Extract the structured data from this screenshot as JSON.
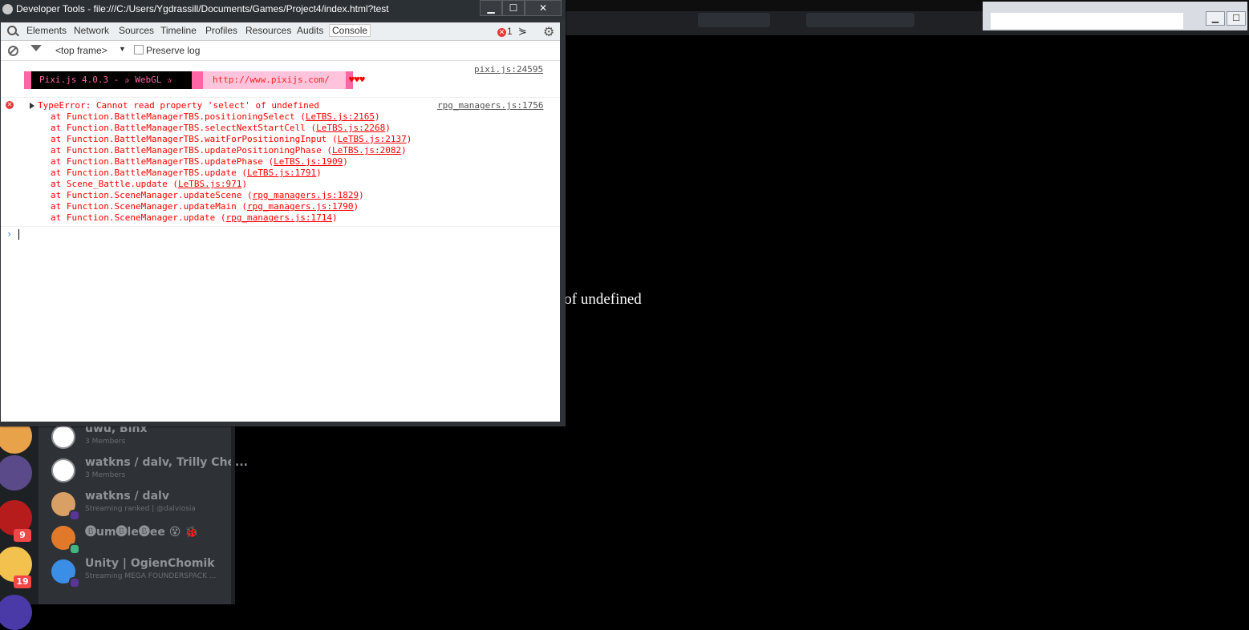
{
  "devtools": {
    "window_title": "Developer Tools - file:///C:/Users/Ygdrassill/Documents/Games/Project4/index.html?test",
    "window_buttons": {
      "minimize": "▁",
      "maximize": "☐",
      "close": "✕"
    },
    "tabs": [
      "Elements",
      "Network",
      "Sources",
      "Timeline",
      "Profiles",
      "Resources",
      "Audits",
      "Console"
    ],
    "active_tab": "Console",
    "error_count": "1",
    "toolbar": {
      "frame_select": "<top frame>",
      "preserve_log_label": "Preserve log",
      "preserve_log_checked": false
    },
    "pixi_banner": {
      "label": "Pixi.js 4.0.3 - ✰ WebGL ✰",
      "url": "http://www.pixijs.com/",
      "hearts": "♥♥♥",
      "source": "pixi.js:24595"
    },
    "error": {
      "message": "TypeError: Cannot read property 'select' of undefined",
      "source": "rpg_managers.js:1756",
      "stack": [
        {
          "text": "at Function.BattleManagerTBS.positioningSelect (",
          "link": "LeTBS.js:2165",
          "end": ")"
        },
        {
          "text": "at Function.BattleManagerTBS.selectNextStartCell (",
          "link": "LeTBS.js:2268",
          "end": ")"
        },
        {
          "text": "at Function.BattleManagerTBS.waitForPositioningInput (",
          "link": "LeTBS.js:2137",
          "end": ")"
        },
        {
          "text": "at Function.BattleManagerTBS.updatePositioningPhase (",
          "link": "LeTBS.js:2082",
          "end": ")"
        },
        {
          "text": "at Function.BattleManagerTBS.updatePhase (",
          "link": "LeTBS.js:1909",
          "end": ")"
        },
        {
          "text": "at Function.BattleManagerTBS.update (",
          "link": "LeTBS.js:1791",
          "end": ")"
        },
        {
          "text": "at Scene_Battle.update (",
          "link": "LeTBS.js:971",
          "end": ")"
        },
        {
          "text": "at Function.SceneManager.updateScene (",
          "link": "rpg_managers.js:1829",
          "end": ")"
        },
        {
          "text": "at Function.SceneManager.updateMain (",
          "link": "rpg_managers.js:1790",
          "end": ")"
        },
        {
          "text": "at Function.SceneManager.update (",
          "link": "rpg_managers.js:1714",
          "end": ")"
        }
      ]
    },
    "prompt": "›"
  },
  "game": {
    "error_title": "TypeError",
    "error_message": "Cannot read property 'select' of undefined"
  },
  "discord": {
    "guild_badges": [
      "9",
      "19"
    ],
    "dms": [
      {
        "name": "uwu, Binx",
        "sub": "3 Members",
        "type": "group"
      },
      {
        "name": "watkns / dalv, Trilly Che...",
        "sub": "3 Members",
        "type": "group"
      },
      {
        "name": "watkns / dalv",
        "sub": "Streaming ranked | @dalviosia",
        "type": "user",
        "status_color": "#593695"
      },
      {
        "name": "🅑um🅑le🅑ee 😵 🐞",
        "sub": "",
        "type": "user",
        "status_color": "#43b581"
      },
      {
        "name": "Unity | OgienChomik",
        "sub": "Streaming MEGA FOUNDERSPACK ...",
        "type": "user",
        "status_color": "#593695"
      }
    ]
  },
  "colors": {
    "error_red": "#ff0000",
    "game_title_yellow": "#ffff00",
    "pixi_pink": "#ff66a5",
    "discord_bg": "#2e3136"
  }
}
